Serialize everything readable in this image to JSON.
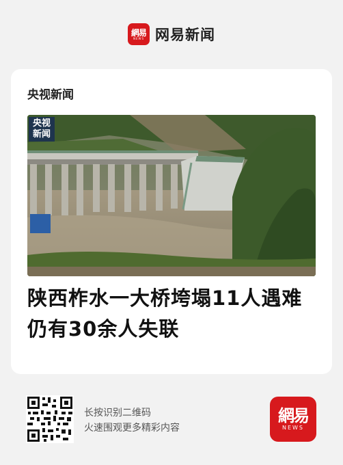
{
  "header": {
    "logo_text": "網易",
    "logo_sub": "NEWS",
    "brand_name": "网易新闻"
  },
  "card": {
    "source": "央视新闻",
    "image_watermark": "央视\n新闻",
    "headline": "陕西柞水一大桥垮塌11人遇难  仍有30余人失联"
  },
  "footer": {
    "qr_line1": "长按识别二维码",
    "qr_line2": "火速围观更多精彩内容",
    "app_logo_text": "網易",
    "app_logo_sub": "NEWS"
  },
  "colors": {
    "brand_red": "#d7191d",
    "page_bg": "#f2f2f2",
    "card_bg": "#ffffff"
  }
}
